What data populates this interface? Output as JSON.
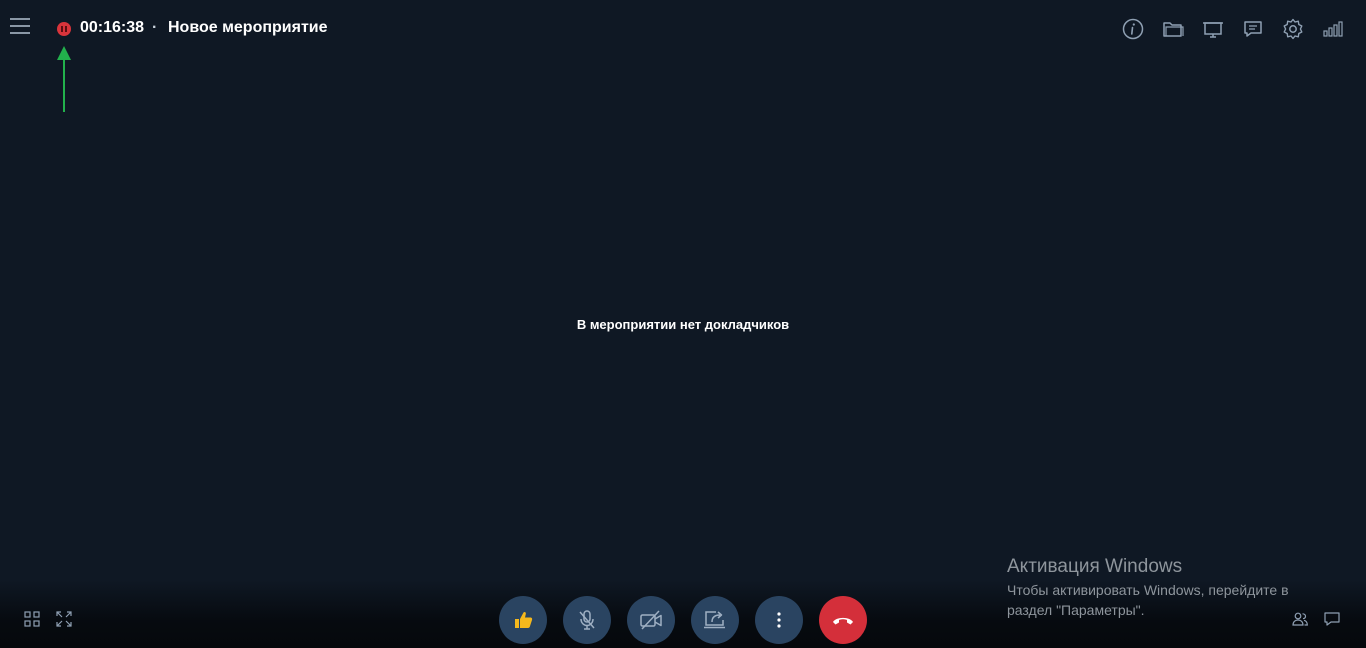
{
  "header": {
    "timer": "00:16:38",
    "separator": "·",
    "event_title": "Новое мероприятие"
  },
  "main": {
    "empty_message": "В мероприятии нет докладчиков"
  },
  "top_icons": [
    "info-icon",
    "folder-icon",
    "presentation-icon",
    "chat-message-icon",
    "settings-gear-icon",
    "network-signal-icon"
  ],
  "controls": [
    "like-icon",
    "microphone-off-icon",
    "camera-off-icon",
    "share-screen-icon",
    "more-vertical-icon",
    "hang-up-icon"
  ],
  "bottom_left": [
    "grid-layout-icon",
    "fullscreen-icon"
  ],
  "bottom_right": [
    "participants-icon",
    "chat-icon"
  ],
  "windows_watermark": {
    "title": "Активация Windows",
    "text": "Чтобы активировать Windows, перейдите в раздел \"Параметры\"."
  },
  "colors": {
    "background": "#0f1824",
    "record_red": "#d9343b",
    "control_button": "#2a4461",
    "hangup_red": "#d42f3a",
    "annotation_arrow": "#22b14c",
    "like_yellow": "#f5b81c"
  }
}
